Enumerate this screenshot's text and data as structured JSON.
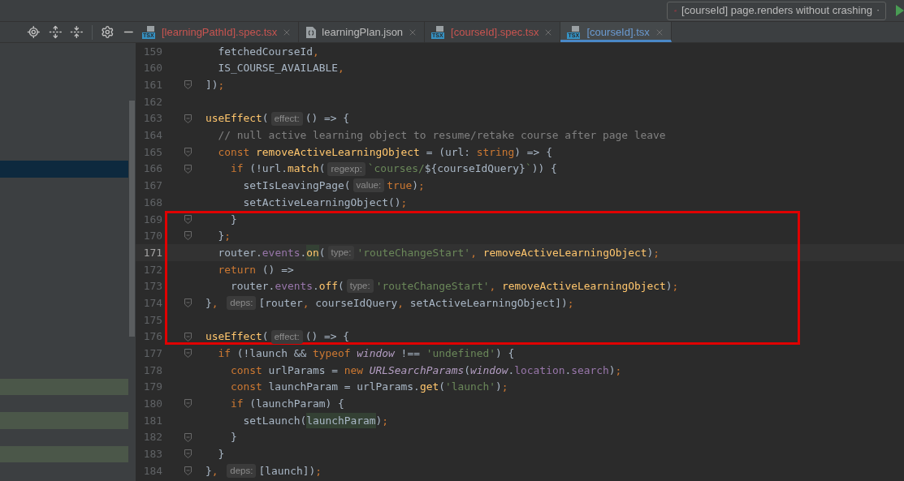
{
  "run_config": {
    "label": "[courseId] page.renders without crashing"
  },
  "tabs": [
    {
      "label": "[learningPathId].spec.tsx",
      "kind": "tsx",
      "badge": "TSX",
      "color": "#c75450",
      "selected": false
    },
    {
      "label": "learningPlan.json",
      "kind": "json",
      "color": "#bbbbbb",
      "selected": false
    },
    {
      "label": "[courseId].spec.tsx",
      "kind": "tsx",
      "badge": "TSX",
      "color": "#c75450",
      "selected": false
    },
    {
      "label": "[courseId].tsx",
      "kind": "tsx",
      "badge": "TSX",
      "color": "#6b9bd2",
      "selected": true
    }
  ],
  "lines": [
    {
      "number": "159",
      "fold": false,
      "current": false,
      "boxed": false,
      "tokens": [
        {
          "kind": "plain",
          "text": "  fetchedCourseId"
        },
        {
          "kind": "kw",
          "text": ","
        }
      ]
    },
    {
      "number": "160",
      "fold": false,
      "current": false,
      "boxed": false,
      "tokens": [
        {
          "kind": "plain",
          "text": "  IS_COURSE_AVAILABLE"
        },
        {
          "kind": "kw",
          "text": ","
        }
      ]
    },
    {
      "number": "161",
      "fold": true,
      "current": false,
      "boxed": false,
      "tokens": [
        {
          "kind": "plain",
          "text": "])"
        },
        {
          "kind": "kw",
          "text": ";"
        }
      ]
    },
    {
      "number": "162",
      "fold": false,
      "current": false,
      "boxed": false
    },
    {
      "number": "163",
      "fold": true,
      "current": false,
      "boxed": false,
      "tokens": [
        {
          "kind": "fn",
          "text": "useEffect"
        },
        {
          "kind": "plain",
          "text": "("
        },
        {
          "kind": "hint",
          "text": "effect:"
        },
        {
          "kind": "plain",
          "text": "() => {"
        }
      ]
    },
    {
      "number": "164",
      "fold": false,
      "current": false,
      "boxed": false,
      "tokens": [
        {
          "kind": "cmt",
          "text": "  // null active learning object to resume/retake course after page leave"
        }
      ]
    },
    {
      "number": "165",
      "fold": true,
      "current": false,
      "boxed": false,
      "tokens": [
        {
          "kind": "kw",
          "text": "  const "
        },
        {
          "kind": "fn",
          "text": "removeActiveLearningObject"
        },
        {
          "kind": "plain",
          "text": " = (url: "
        },
        {
          "kind": "kw",
          "text": "string"
        },
        {
          "kind": "plain",
          "text": ") => {"
        }
      ]
    },
    {
      "number": "166",
      "fold": true,
      "current": false,
      "boxed": false,
      "color": "#0d293e",
      "tokens": [
        {
          "kind": "kw",
          "text": "    if "
        },
        {
          "kind": "plain",
          "text": "(!url."
        },
        {
          "kind": "fn",
          "text": "match"
        },
        {
          "kind": "plain",
          "text": "("
        },
        {
          "kind": "hint",
          "text": "regexp:"
        },
        {
          "kind": "str",
          "text": "`courses/"
        },
        {
          "kind": "plain",
          "text": "${courseIdQuery}"
        },
        {
          "kind": "str",
          "text": "`"
        },
        {
          "kind": "plain",
          "text": ")) {"
        }
      ]
    },
    {
      "number": "167",
      "fold": false,
      "current": false,
      "boxed": false,
      "tokens": [
        {
          "kind": "plain",
          "text": "      setIsLeavingPage("
        },
        {
          "kind": "hint",
          "text": "value:"
        },
        {
          "kind": "kw",
          "text": "true"
        },
        {
          "kind": "plain",
          "text": ")"
        },
        {
          "kind": "kw",
          "text": ";"
        }
      ]
    },
    {
      "number": "168",
      "fold": false,
      "current": false,
      "boxed": false,
      "tokens": [
        {
          "kind": "plain",
          "text": "      setActiveLearningObject()"
        },
        {
          "kind": "kw",
          "text": ";"
        }
      ]
    },
    {
      "number": "169",
      "fold": true,
      "current": false,
      "boxed": true,
      "tokens": [
        {
          "kind": "plain",
          "text": "    }"
        }
      ]
    },
    {
      "number": "170",
      "fold": true,
      "current": false,
      "boxed": true,
      "tokens": [
        {
          "kind": "plain",
          "text": "  }"
        },
        {
          "kind": "kw",
          "text": ";"
        }
      ]
    },
    {
      "number": "171",
      "fold": false,
      "current": true,
      "boxed": true,
      "tokens": [
        {
          "kind": "plain",
          "text": "  router."
        },
        {
          "kind": "field",
          "text": "events"
        },
        {
          "kind": "plain",
          "text": "."
        },
        {
          "kind": "fnhl",
          "text": "on"
        },
        {
          "kind": "plain",
          "text": "("
        },
        {
          "kind": "hint",
          "text": "type:"
        },
        {
          "kind": "str",
          "text": "'routeChangeStart'"
        },
        {
          "kind": "kw",
          "text": ", "
        },
        {
          "kind": "fn",
          "text": "removeActiveLearningObject"
        },
        {
          "kind": "plain",
          "text": ")"
        },
        {
          "kind": "kw",
          "text": ";"
        }
      ]
    },
    {
      "number": "172",
      "fold": false,
      "current": false,
      "boxed": true,
      "tokens": [
        {
          "kind": "kw",
          "text": "  return "
        },
        {
          "kind": "plain",
          "text": "() =>"
        }
      ]
    },
    {
      "number": "173",
      "fold": false,
      "current": false,
      "boxed": true,
      "tokens": [
        {
          "kind": "plain",
          "text": "    router."
        },
        {
          "kind": "field",
          "text": "events"
        },
        {
          "kind": "plain",
          "text": "."
        },
        {
          "kind": "fn",
          "text": "off"
        },
        {
          "kind": "plain",
          "text": "("
        },
        {
          "kind": "hint",
          "text": "type:"
        },
        {
          "kind": "str",
          "text": "'routeChangeStart'"
        },
        {
          "kind": "kw",
          "text": ", "
        },
        {
          "kind": "fn",
          "text": "removeActiveLearningObject"
        },
        {
          "kind": "plain",
          "text": ")"
        },
        {
          "kind": "kw",
          "text": ";"
        }
      ]
    },
    {
      "number": "174",
      "fold": true,
      "current": false,
      "boxed": true,
      "tokens": [
        {
          "kind": "plain",
          "text": "}"
        },
        {
          "kind": "kw",
          "text": ", "
        },
        {
          "kind": "hint",
          "text": "deps:"
        },
        {
          "kind": "plain",
          "text": "[router"
        },
        {
          "kind": "kw",
          "text": ", "
        },
        {
          "kind": "plain",
          "text": "courseIdQuery"
        },
        {
          "kind": "kw",
          "text": ", "
        },
        {
          "kind": "plain",
          "text": "setActiveLearningObject])"
        },
        {
          "kind": "kw",
          "text": ";"
        }
      ]
    },
    {
      "number": "175",
      "fold": false,
      "current": false,
      "boxed": true
    },
    {
      "number": "176",
      "fold": true,
      "current": false,
      "boxed": true,
      "tokens": [
        {
          "kind": "fn",
          "text": "useEffect"
        },
        {
          "kind": "plain",
          "text": "("
        },
        {
          "kind": "hint",
          "text": "effect:"
        },
        {
          "kind": "plain",
          "text": "() => {"
        }
      ]
    },
    {
      "number": "177",
      "fold": true,
      "current": false,
      "boxed": false,
      "tokens": [
        {
          "kind": "kw",
          "text": "  if "
        },
        {
          "kind": "plain",
          "text": "(!launch && "
        },
        {
          "kind": "kw",
          "text": "typeof "
        },
        {
          "kind": "ital",
          "text": "window"
        },
        {
          "kind": "plain",
          "text": " !== "
        },
        {
          "kind": "str",
          "text": "'undefined'"
        },
        {
          "kind": "plain",
          "text": ") {"
        }
      ]
    },
    {
      "number": "178",
      "fold": false,
      "current": false,
      "boxed": false,
      "tokens": [
        {
          "kind": "kw",
          "text": "    const "
        },
        {
          "kind": "plain",
          "text": "urlParams = "
        },
        {
          "kind": "kw",
          "text": "new "
        },
        {
          "kind": "ital",
          "text": "URLSearchParams"
        },
        {
          "kind": "plain",
          "text": "("
        },
        {
          "kind": "ital",
          "text": "window"
        },
        {
          "kind": "plain",
          "text": "."
        },
        {
          "kind": "field",
          "text": "location"
        },
        {
          "kind": "plain",
          "text": "."
        },
        {
          "kind": "field",
          "text": "search"
        },
        {
          "kind": "plain",
          "text": ")"
        },
        {
          "kind": "kw",
          "text": ";"
        }
      ]
    },
    {
      "number": "179",
      "fold": false,
      "current": false,
      "boxed": false,
      "color": "#4b5749",
      "tokens": [
        {
          "kind": "kw",
          "text": "    const "
        },
        {
          "kind": "plain",
          "text": "launchParam = urlParams."
        },
        {
          "kind": "fn",
          "text": "get"
        },
        {
          "kind": "plain",
          "text": "("
        },
        {
          "kind": "str",
          "text": "'launch'"
        },
        {
          "kind": "plain",
          "text": ")"
        },
        {
          "kind": "kw",
          "text": ";"
        }
      ]
    },
    {
      "number": "180",
      "fold": true,
      "current": false,
      "boxed": false,
      "tokens": [
        {
          "kind": "kw",
          "text": "    if "
        },
        {
          "kind": "plain",
          "text": "(launchParam) {"
        }
      ]
    },
    {
      "number": "181",
      "fold": false,
      "current": false,
      "boxed": false,
      "color": "#4b5749",
      "tokens": [
        {
          "kind": "plain",
          "text": "      setLaunch("
        },
        {
          "kind": "varhl",
          "text": "launchParam"
        },
        {
          "kind": "plain",
          "text": ")"
        },
        {
          "kind": "kw",
          "text": ";"
        }
      ]
    },
    {
      "number": "182",
      "fold": true,
      "current": false,
      "boxed": false,
      "tokens": [
        {
          "kind": "plain",
          "text": "    }"
        }
      ]
    },
    {
      "number": "183",
      "fold": true,
      "current": false,
      "boxed": false,
      "color": "#4b5749",
      "tokens": [
        {
          "kind": "plain",
          "text": "  }"
        }
      ]
    },
    {
      "number": "184",
      "fold": true,
      "current": false,
      "boxed": false,
      "tokens": [
        {
          "kind": "plain",
          "text": "}"
        },
        {
          "kind": "kw",
          "text": ", "
        },
        {
          "kind": "hint",
          "text": "deps:"
        },
        {
          "kind": "plain",
          "text": "[launch])"
        },
        {
          "kind": "kw",
          "text": ";"
        }
      ]
    }
  ]
}
